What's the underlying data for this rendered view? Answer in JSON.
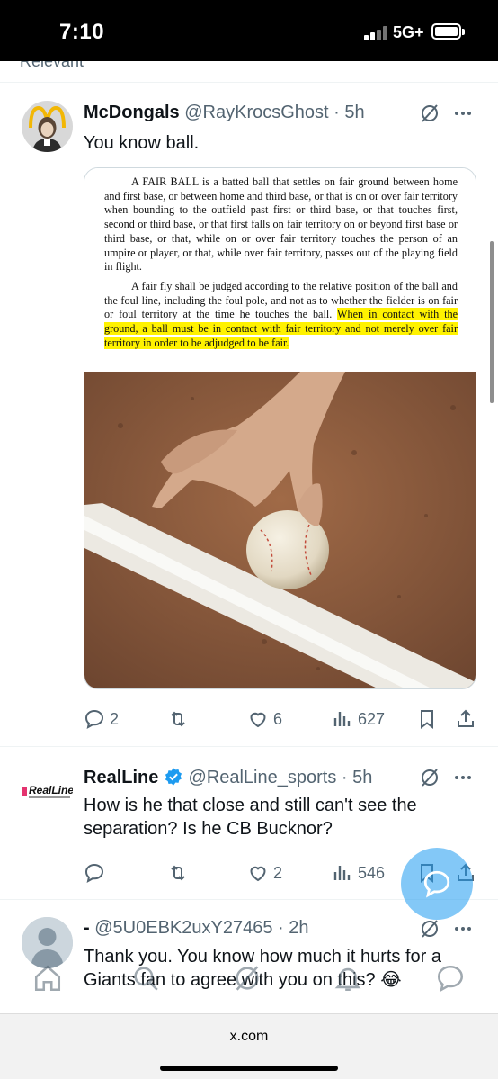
{
  "status": {
    "time": "7:10",
    "network": "5G+"
  },
  "top_cutoff_text": "Relevant",
  "tweets": [
    {
      "name": "McDongals",
      "handle": "@RayKrocsGhost",
      "time": "· 5h",
      "text": "You know ball.",
      "media": {
        "paragraph1": "A FAIR BALL is a batted ball that settles on fair ground between home and first base, or between home and third base, or that is on or over fair territory when bounding to the outfield past first or third base, or that touches first, second or third base, or that first falls on fair territory on or beyond first base or third base, or that, while on or over fair territory touches the person of an umpire or player, or that, while over fair territory, passes out of the playing field in flight.",
        "paragraph2_plain": "A fair fly shall be judged according to the relative position of the ball and the foul line, including the foul pole, and not as to whether the fielder is on fair or foul territory at the time he touches the ball.",
        "paragraph2_highlight": "When in contact with the ground, a ball must be in contact with fair territory and not merely over fair territory in order to be adjudged to be fair."
      },
      "replies": "2",
      "retweets": "",
      "likes": "6",
      "views": "627"
    },
    {
      "name": "RealLine",
      "handle": "@RealLine_sports",
      "time": "· 5h",
      "text": "How is he that close and still can't see the separation? Is he CB Bucknor?",
      "avatar_text": "RealLine",
      "replies": "",
      "retweets": "",
      "likes": "2",
      "views": "546"
    },
    {
      "name": "-",
      "handle": "@5U0EBK2uxY27465",
      "time": "· 2h",
      "text": "Thank you. You know how much it hurts for a Giants fan to agree with you on this? 😂"
    }
  ],
  "urlbar": {
    "url": "x.com"
  },
  "colors": {
    "accent": "#1d9bf0",
    "verified": "#1d9bf0",
    "muted": "#536471",
    "highlight": "#fff200"
  }
}
